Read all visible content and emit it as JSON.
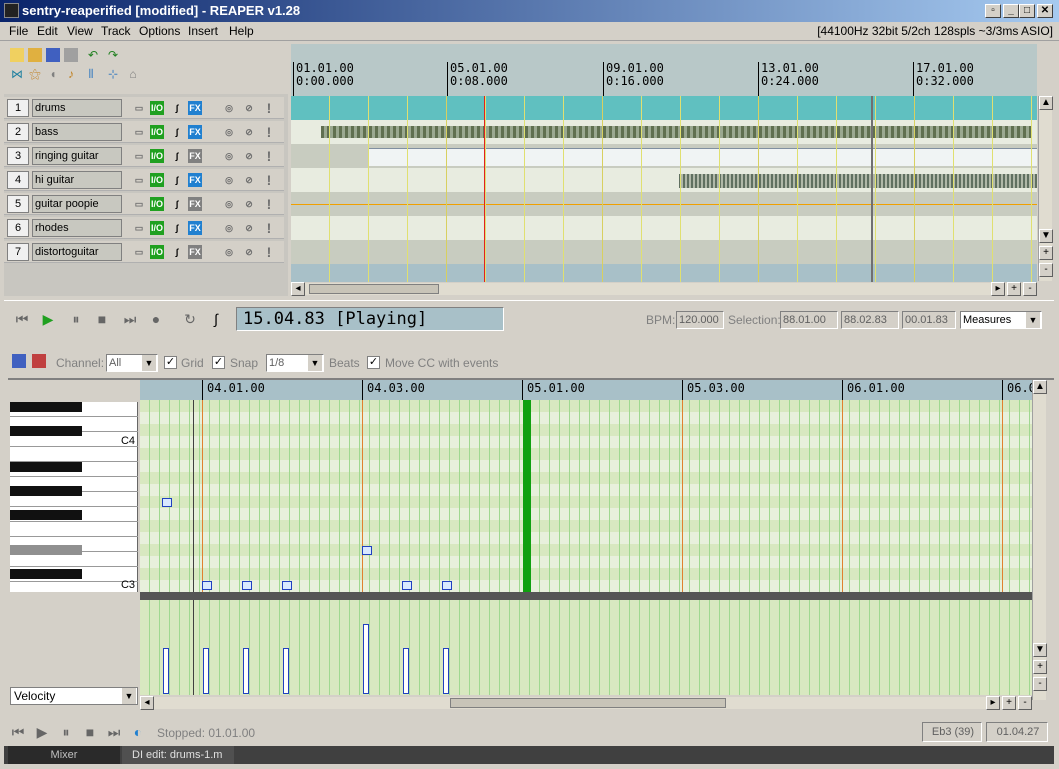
{
  "window": {
    "title": "sentry-reaperified [modified] - REAPER v1.28"
  },
  "menu": [
    {
      "label": "File"
    },
    {
      "label": "Edit"
    },
    {
      "label": "View"
    },
    {
      "label": "Track"
    },
    {
      "label": "Options"
    },
    {
      "label": "Insert"
    },
    {
      "label": "Help"
    }
  ],
  "audio_status": "[44100Hz 32bit 5/2ch 128spls ~3/3ms ASIO]",
  "timeline": {
    "marks": [
      {
        "measure": "01.01.00",
        "time": "0:00.000"
      },
      {
        "measure": "05.01.00",
        "time": "0:08.000"
      },
      {
        "measure": "09.01.00",
        "time": "0:16.000"
      },
      {
        "measure": "13.01.00",
        "time": "0:24.000"
      },
      {
        "measure": "17.01.00",
        "time": "0:32.000"
      }
    ]
  },
  "tracks": [
    {
      "num": "1",
      "name": "drums"
    },
    {
      "num": "2",
      "name": "bass"
    },
    {
      "num": "3",
      "name": "ringing guitar"
    },
    {
      "num": "4",
      "name": "hi guitar"
    },
    {
      "num": "5",
      "name": "guitar poopie"
    },
    {
      "num": "6",
      "name": "rhodes"
    },
    {
      "num": "7",
      "name": "distortoguitar"
    }
  ],
  "track_buttons": {
    "io": "I/O",
    "fx": "FX"
  },
  "transport": {
    "time_display": "15.04.83 [Playing]",
    "bpm_label": "BPM:",
    "bpm": "120.000",
    "selection_label": "Selection:",
    "sel_start": "88.01.00",
    "sel_end": "88.02.83",
    "sel_len": "00.01.83",
    "time_mode": "Measures"
  },
  "midi": {
    "channel_label": "Channel:",
    "channel": "All",
    "grid_label": "Grid",
    "snap_label": "Snap",
    "snap_value": "1/8",
    "beats_label": "Beats",
    "move_cc_label": "Move CC with events",
    "ruler": [
      "04.01.00",
      "04.03.00",
      "05.01.00",
      "05.03.00",
      "06.01.00",
      "06.0"
    ],
    "key_c4": "C4",
    "key_c3": "C3",
    "cc_lane": "Velocity",
    "status": "Stopped: 01.01.00",
    "note_info": "Eb3 (39)",
    "pos_info": "01.04.27"
  },
  "tabs": [
    {
      "label": "Mixer"
    },
    {
      "label": "DI edit: drums-1.m"
    }
  ]
}
